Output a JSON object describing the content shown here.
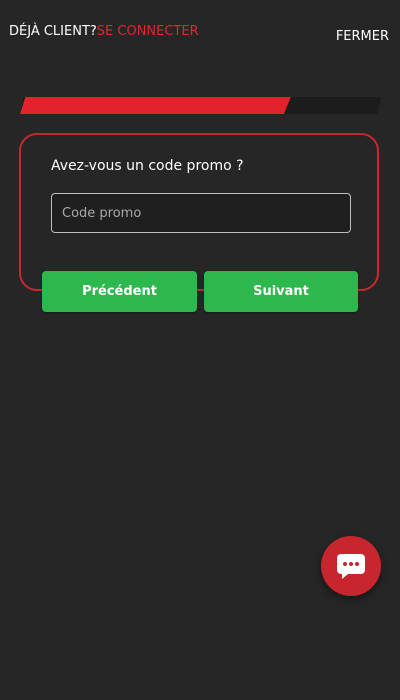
{
  "header": {
    "already_client": "DÉJÀ CLIENT?",
    "login_link": "SE CONNECTER",
    "close_label": "FERMER"
  },
  "progress": {
    "percent": 75
  },
  "promo": {
    "question": "Avez-vous un code promo ?",
    "input_placeholder": "Code promo",
    "input_value": ""
  },
  "buttons": {
    "previous_label": "Précédent",
    "next_label": "Suivant"
  },
  "chat": {
    "icon": "chat-bubble-icon"
  },
  "colors": {
    "background": "#262626",
    "accent_red": "#e1232b",
    "button_green": "#2db84d"
  }
}
